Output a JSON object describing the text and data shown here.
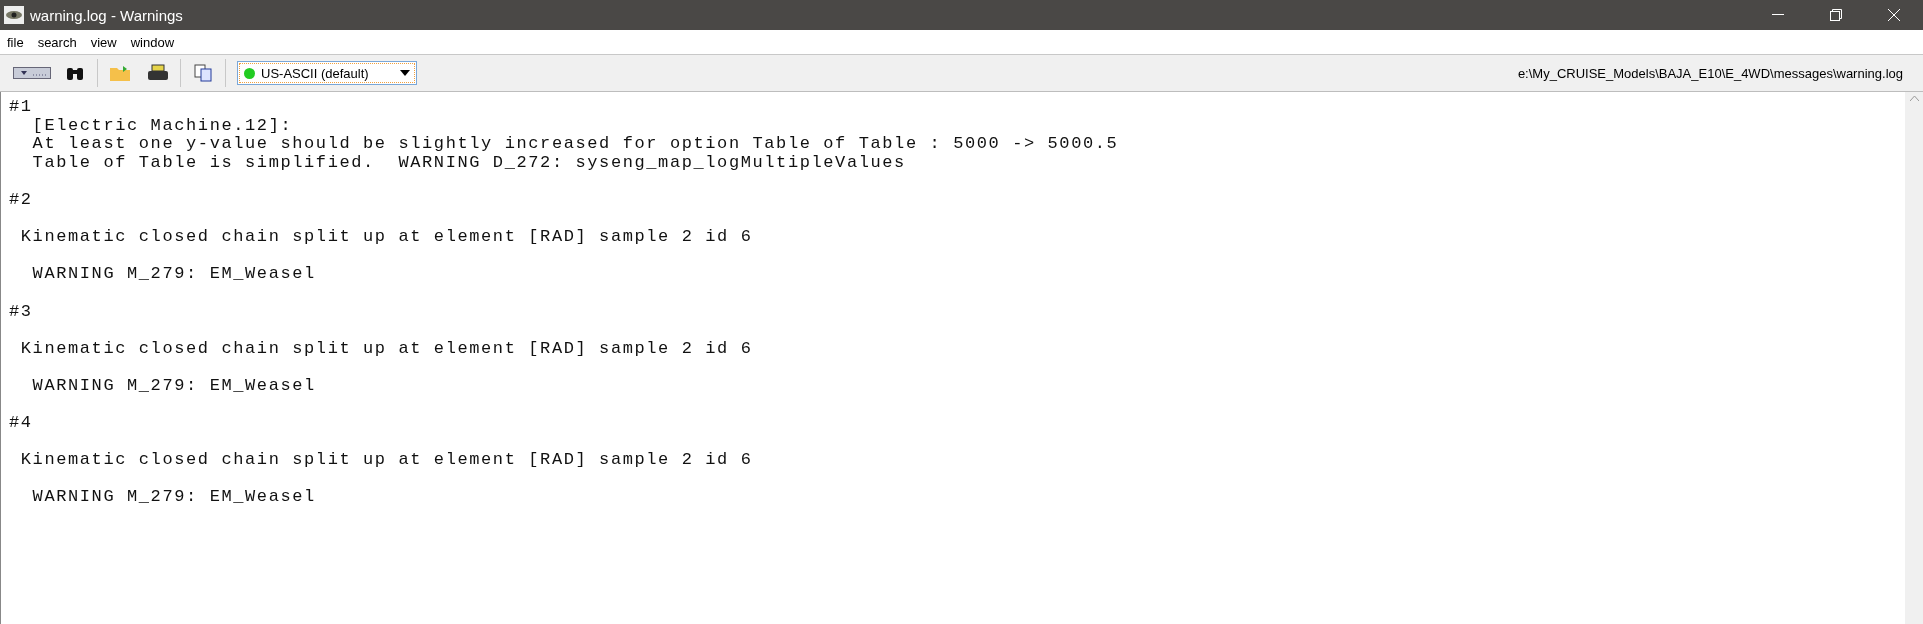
{
  "window": {
    "title": "warning.log - Warnings"
  },
  "menu": [
    {
      "label": "file"
    },
    {
      "label": "search"
    },
    {
      "label": "view"
    },
    {
      "label": "window"
    }
  ],
  "encoding": {
    "value": "US-ASCII (default)"
  },
  "file_path": "e:\\My_CRUISE_Models\\BAJA_E10\\E_4WD\\messages\\warning.log",
  "log_paragraphs": [
    [
      "#1",
      "  [Electric Machine.12]:",
      "  At least one y-value should be slightly increased for option Table of Table : 5000 -> 5000.5",
      "  Table of Table is simplified.  WARNING D_272: syseng_map_logMultipleValues"
    ],
    [
      "#2"
    ],
    [
      " Kinematic closed chain split up at element [RAD] sample 2 id 6"
    ],
    [
      "  WARNING M_279: EM_Weasel"
    ],
    [
      "#3"
    ],
    [
      " Kinematic closed chain split up at element [RAD] sample 2 id 6"
    ],
    [
      "  WARNING M_279: EM_Weasel"
    ],
    [
      "#4"
    ],
    [
      " Kinematic closed chain split up at element [RAD] sample 2 id 6"
    ],
    [
      "  WARNING M_279: EM_Weasel"
    ]
  ]
}
